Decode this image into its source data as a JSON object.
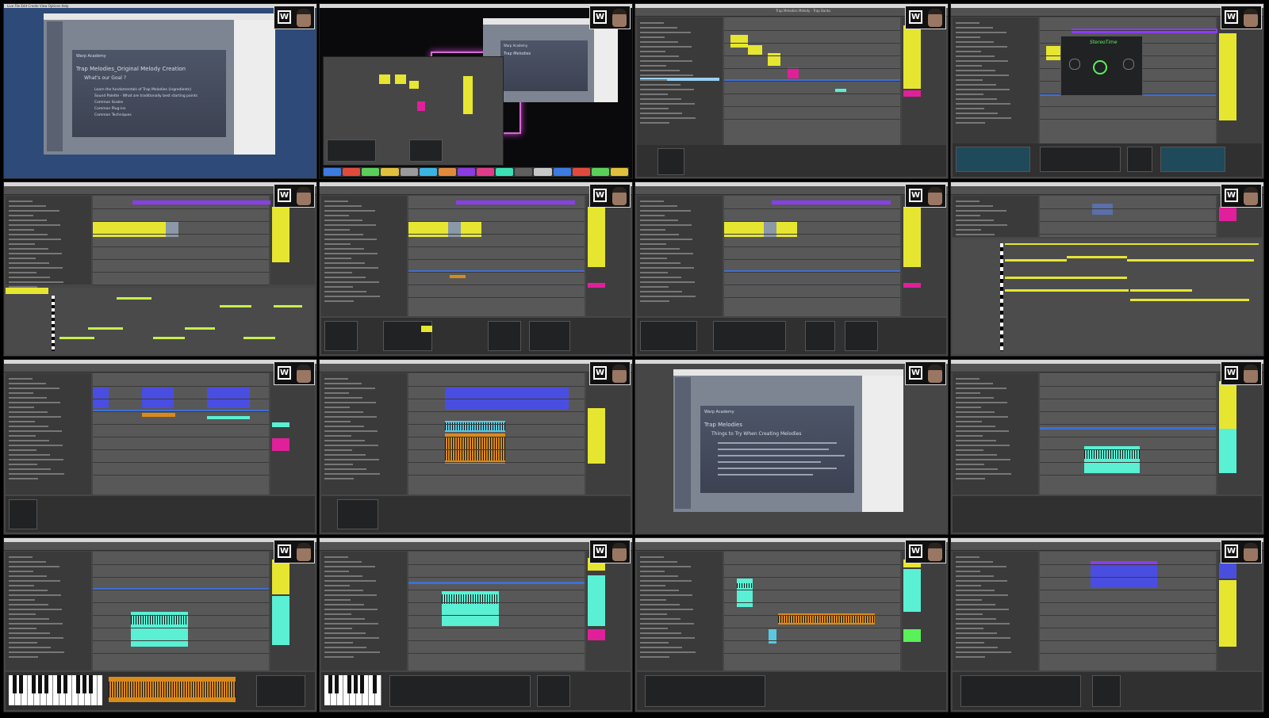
{
  "app": {
    "window_title": "Trap Melodies Melody - Trap Banks",
    "menubar": "Live   File   Edit   Create   View   Options   Help"
  },
  "slides": {
    "brand": "Warp Academy",
    "slide1": {
      "title": "Trap Melodies_Original Melody Creation",
      "heading": "What's our Goal ?",
      "bullets": [
        "Learn the fundamentals of Trap Melodies (ingredients)",
        "Sound Palette - What are traditionally best starting points",
        "Common Scales",
        "Common Plug-ins",
        "Common Techniques"
      ]
    },
    "slide3": {
      "title": "Trap Melodies",
      "heading": "Things to Try When Creating Melodies"
    }
  },
  "plugin": {
    "name": "StereoTime"
  },
  "colors": {
    "yellow": "#e6e631",
    "blue": "#4a4ee0",
    "violet": "#8a3df0",
    "magenta": "#e0209a",
    "orange": "#d98a1c",
    "cyan": "#5af0d4",
    "lime": "#c6f04a",
    "track_blue": "#3f6fd6",
    "selection": "#9ad0f0"
  }
}
